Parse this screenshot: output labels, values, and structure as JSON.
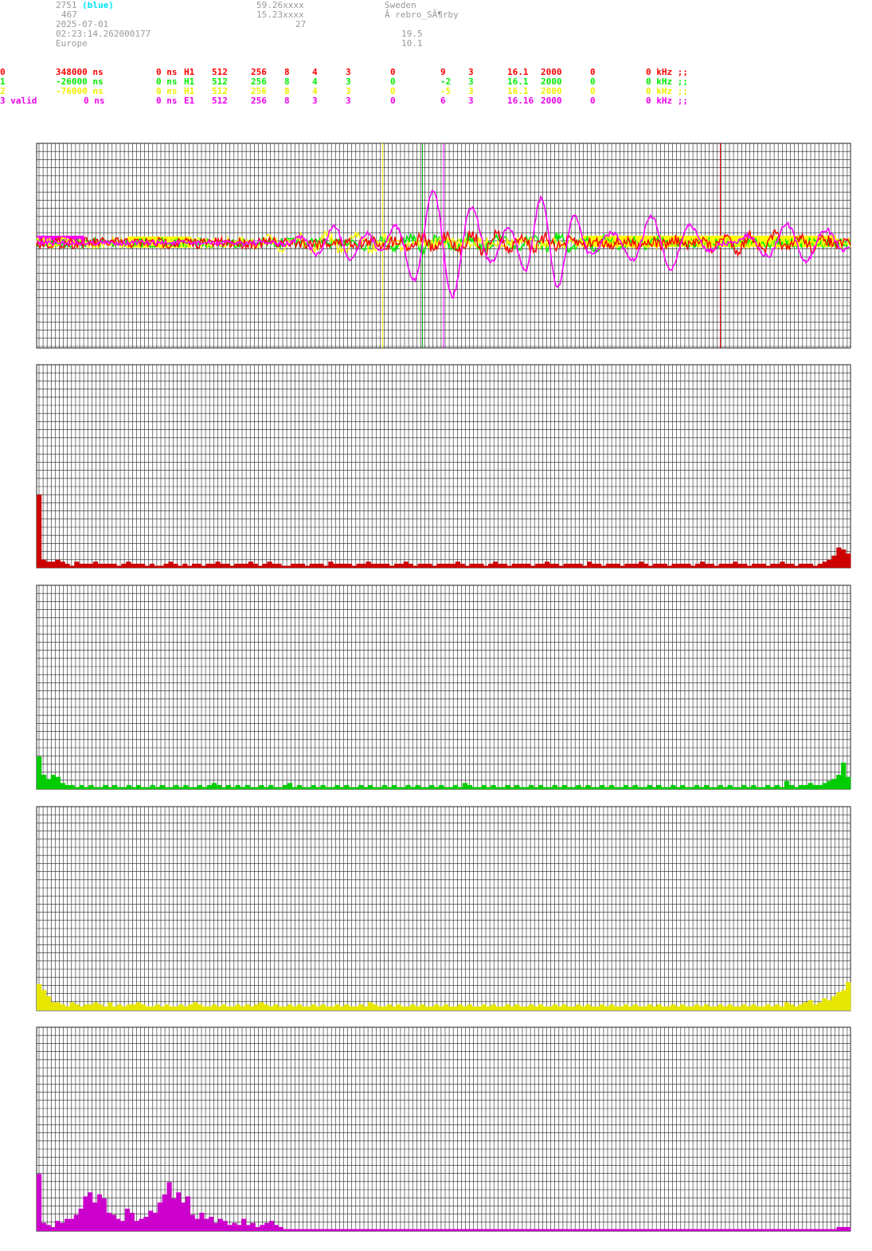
{
  "header": {
    "id": "2751",
    "tag": "(blue)",
    "count": "467",
    "date": "2025-07-01",
    "time": "02:23:14.262000177",
    "region": "Europe",
    "lat": "59.26xxxx",
    "lon": "15.23xxxx",
    "num": "27",
    "country": "Sweden",
    "place": "Ã rebro_SÃ¶rby",
    "val1": "19.5",
    "val2": "10.1"
  },
  "channels": [
    {
      "idx": "0",
      "offset": "348000 ns",
      "ns2": "0 ns",
      "mode": "H1",
      "a": "512",
      "b": "256",
      "c": "8",
      "d": "4",
      "e": "3",
      "f": "0",
      "g": "9",
      "h": "3",
      "freq": "16.1",
      "rate": "2000",
      "z": "0",
      "khz": "0 kHz ;;"
    },
    {
      "idx": "1",
      "offset": "-26000 ns",
      "ns2": "0 ns",
      "mode": "H1",
      "a": "512",
      "b": "256",
      "c": "8",
      "d": "4",
      "e": "3",
      "f": "0",
      "g": "-2",
      "h": "3",
      "freq": "16.1",
      "rate": "2000",
      "z": "0",
      "khz": "0 kHz ;;"
    },
    {
      "idx": "2",
      "offset": "-76000 ns",
      "ns2": "0 ns",
      "mode": "H1",
      "a": "512",
      "b": "256",
      "c": "8",
      "d": "4",
      "e": "3",
      "f": "0",
      "g": "-5",
      "h": "3",
      "freq": "16.1",
      "rate": "2000",
      "z": "0",
      "khz": "0 kHz ;;"
    },
    {
      "idx": "3 valid",
      "offset": "0 ns",
      "ns2": "0 ns",
      "mode": "E1",
      "a": "512",
      "b": "256",
      "c": "8",
      "d": "3",
      "e": "3",
      "f": "0",
      "g": "6",
      "h": "3",
      "freq": "16.16",
      "rate": "2000",
      "z": "0",
      "khz": "0 kHz ;;"
    }
  ],
  "colors": {
    "ch0": "#ff0000",
    "ch1": "#00ee00",
    "ch2": "#ffff00",
    "ch3": "#ff00ff",
    "tag": "#00e5ff",
    "hist0": "#cc0000",
    "hist1": "#00cc00",
    "hist2": "#e6e600",
    "hist3": "#cc00cc",
    "grid": "#222222"
  },
  "chart_data": [
    {
      "type": "line",
      "panel": "waveform",
      "markers": {
        "yellow": 0.425,
        "green": 0.474,
        "magenta": 0.5,
        "red": 0.84
      },
      "grid": true
    },
    {
      "type": "bar",
      "panel": "histogram-ch0",
      "ylim": [
        0,
        100
      ],
      "values": [
        36,
        4,
        3,
        3,
        4,
        3,
        2,
        1,
        3,
        2,
        2,
        2,
        3,
        2,
        2,
        2,
        2,
        1,
        2,
        3,
        2,
        2,
        2,
        1,
        2,
        1,
        1,
        2,
        3,
        2,
        1,
        2,
        1,
        2,
        2,
        1,
        2,
        2,
        3,
        2,
        2,
        1,
        2,
        2,
        2,
        3,
        2,
        1,
        2,
        3,
        2,
        2,
        1,
        1,
        2,
        2,
        2,
        1,
        2,
        2,
        2,
        1,
        3,
        2,
        2,
        2,
        2,
        1,
        2,
        2,
        3,
        2,
        2,
        2,
        2,
        1,
        2,
        2,
        3,
        2,
        1,
        2,
        2,
        2,
        1,
        2,
        2,
        2,
        2,
        3,
        2,
        1,
        2,
        2,
        2,
        1,
        2,
        3,
        2,
        2,
        1,
        2,
        2,
        2,
        2,
        1,
        2,
        2,
        3,
        2,
        2,
        1,
        2,
        2,
        2,
        2,
        1,
        3,
        2,
        2,
        1,
        2,
        2,
        2,
        1,
        2,
        2,
        2,
        3,
        2,
        1,
        2,
        2,
        2,
        1,
        2,
        2,
        2,
        2,
        1,
        2,
        3,
        2,
        2,
        1,
        2,
        2,
        2,
        3,
        2,
        2,
        1,
        2,
        2,
        2,
        1,
        2,
        2,
        3,
        2,
        2,
        1,
        2,
        2,
        2,
        1,
        2,
        3,
        4,
        6,
        10,
        9,
        7
      ]
    },
    {
      "type": "bar",
      "panel": "histogram-ch1",
      "ylim": [
        0,
        100
      ],
      "values": [
        16,
        7,
        5,
        7,
        6,
        3,
        2,
        2,
        1,
        2,
        1,
        2,
        1,
        1,
        2,
        1,
        2,
        1,
        1,
        2,
        1,
        2,
        1,
        1,
        2,
        1,
        2,
        1,
        1,
        2,
        1,
        2,
        1,
        1,
        2,
        1,
        2,
        3,
        2,
        1,
        2,
        1,
        2,
        1,
        2,
        1,
        1,
        2,
        1,
        2,
        1,
        1,
        2,
        3,
        1,
        2,
        1,
        1,
        2,
        1,
        2,
        1,
        1,
        2,
        1,
        2,
        1,
        1,
        2,
        1,
        2,
        1,
        1,
        2,
        1,
        2,
        1,
        1,
        2,
        1,
        2,
        1,
        1,
        2,
        1,
        2,
        1,
        1,
        2,
        1,
        3,
        2,
        1,
        1,
        2,
        1,
        2,
        1,
        1,
        2,
        1,
        2,
        1,
        1,
        2,
        1,
        2,
        1,
        1,
        2,
        1,
        2,
        1,
        1,
        2,
        1,
        2,
        1,
        1,
        2,
        1,
        2,
        1,
        1,
        2,
        1,
        2,
        1,
        1,
        2,
        1,
        2,
        1,
        1,
        2,
        1,
        2,
        1,
        1,
        2,
        1,
        2,
        1,
        1,
        2,
        1,
        2,
        1,
        1,
        2,
        1,
        2,
        1,
        1,
        2,
        1,
        2,
        1,
        4,
        2,
        1,
        2,
        2,
        3,
        2,
        2,
        3,
        4,
        5,
        7,
        13,
        6
      ]
    },
    {
      "type": "bar",
      "panel": "histogram-ch2",
      "ylim": [
        0,
        100
      ],
      "values": [
        13,
        10,
        7,
        4,
        4,
        3,
        2,
        4,
        3,
        2,
        3,
        3,
        4,
        3,
        2,
        4,
        2,
        3,
        2,
        3,
        3,
        4,
        3,
        2,
        2,
        3,
        2,
        3,
        2,
        2,
        3,
        2,
        3,
        4,
        3,
        2,
        2,
        3,
        2,
        3,
        2,
        2,
        3,
        2,
        3,
        2,
        3,
        4,
        3,
        2,
        3,
        2,
        2,
        3,
        2,
        3,
        2,
        2,
        3,
        2,
        3,
        2,
        2,
        3,
        2,
        3,
        2,
        2,
        3,
        2,
        4,
        3,
        2,
        2,
        3,
        2,
        3,
        2,
        2,
        3,
        2,
        3,
        2,
        2,
        3,
        2,
        3,
        2,
        2,
        3,
        2,
        3,
        2,
        2,
        3,
        2,
        3,
        2,
        2,
        3,
        2,
        3,
        2,
        2,
        3,
        2,
        3,
        2,
        2,
        3,
        2,
        3,
        2,
        2,
        3,
        2,
        3,
        2,
        2,
        3,
        2,
        3,
        2,
        2,
        3,
        2,
        3,
        2,
        2,
        3,
        2,
        3,
        2,
        2,
        3,
        2,
        3,
        2,
        2,
        3,
        2,
        3,
        2,
        2,
        3,
        2,
        3,
        2,
        2,
        3,
        2,
        3,
        2,
        2,
        3,
        2,
        3,
        2,
        4,
        3,
        2,
        3,
        4,
        5,
        3,
        4,
        6,
        5,
        7,
        9,
        10,
        14
      ]
    },
    {
      "type": "bar",
      "panel": "histogram-ch3",
      "ylim": [
        0,
        100
      ],
      "values": [
        28,
        4,
        3,
        2,
        5,
        4,
        6,
        6,
        8,
        11,
        17,
        19,
        14,
        18,
        16,
        9,
        8,
        6,
        5,
        11,
        9,
        5,
        6,
        7,
        10,
        9,
        14,
        18,
        24,
        16,
        19,
        14,
        17,
        8,
        6,
        9,
        6,
        7,
        4,
        6,
        5,
        3,
        4,
        3,
        6,
        3,
        4,
        2,
        3,
        4,
        5,
        3,
        2,
        1,
        1,
        1,
        1,
        1,
        1,
        1,
        1,
        1,
        1,
        1,
        1,
        1,
        1,
        1,
        1,
        1,
        1,
        1,
        1,
        1,
        1,
        1,
        1,
        1,
        1,
        1,
        1,
        1,
        1,
        1,
        1,
        1,
        1,
        1,
        1,
        1,
        1,
        1,
        1,
        1,
        1,
        1,
        1,
        1,
        1,
        1,
        1,
        1,
        1,
        1,
        1,
        1,
        1,
        1,
        1,
        1,
        1,
        1,
        1,
        1,
        1,
        1,
        1,
        1,
        1,
        1,
        1,
        1,
        1,
        1,
        1,
        1,
        1,
        1,
        1,
        1,
        1,
        1,
        1,
        1,
        1,
        1,
        1,
        1,
        1,
        1,
        1,
        1,
        1,
        1,
        1,
        1,
        1,
        1,
        1,
        1,
        1,
        1,
        1,
        1,
        1,
        1,
        1,
        1,
        1,
        1,
        1,
        1,
        1,
        1,
        1,
        1,
        1,
        1,
        1,
        1,
        1,
        1,
        2,
        2,
        2
      ]
    }
  ]
}
